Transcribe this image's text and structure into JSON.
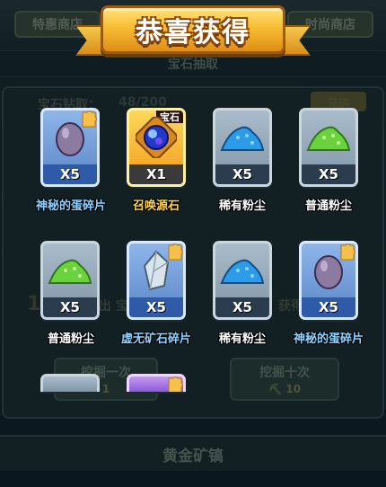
{
  "background": {
    "tab_left": "特惠商店",
    "tab_right": "时尚商店",
    "subtitle": "宝石抽取",
    "panel_label": "宝石钻取：",
    "panel_count": "48/200",
    "corner_button": "兑换",
    "hint_number": "12",
    "hint_text": "出  宝石碎",
    "hint_text2": "获得",
    "btn_dig_once": "挖掘一次",
    "btn_dig_once_cost": "1",
    "btn_dig_ten": "挖掘十次",
    "btn_dig_ten_cost": "10",
    "bottom_title": "黄金矿镐"
  },
  "title": "恭喜获得",
  "rewards": [
    {
      "name": "神秘的蛋碎片",
      "qty": "X5",
      "icon": "mystery-egg-icon",
      "rarity": "blue",
      "puzzle": true
    },
    {
      "name": "召唤源石",
      "qty": "X1",
      "icon": "summon-orb-icon",
      "rarity": "gold",
      "tag": "宝石"
    },
    {
      "name": "稀有粉尘",
      "qty": "X5",
      "icon": "blue-dust-icon",
      "rarity": "gray"
    },
    {
      "name": "普通粉尘",
      "qty": "X5",
      "icon": "green-dust-icon",
      "rarity": "gray"
    },
    {
      "name": "普通粉尘",
      "qty": "X5",
      "icon": "green-dust-icon",
      "rarity": "gray"
    },
    {
      "name": "虚无矿石碎片",
      "qty": "X5",
      "icon": "crystal-ore-icon",
      "rarity": "blue",
      "puzzle": true
    },
    {
      "name": "稀有粉尘",
      "qty": "X5",
      "icon": "blue-dust-icon",
      "rarity": "gray"
    },
    {
      "name": "神秘的蛋碎片",
      "qty": "X5",
      "icon": "mystery-egg-icon",
      "rarity": "blue",
      "puzzle": true
    }
  ],
  "colors": {
    "ribbon": "#f7bd32",
    "card_blue": "#5a86c8",
    "card_gold": "#f09a1c",
    "card_gray": "#7f95a6",
    "card_purple": "#8d5ad6",
    "name_blue": "#8fd0ff",
    "name_gold": "#ffd24a"
  }
}
